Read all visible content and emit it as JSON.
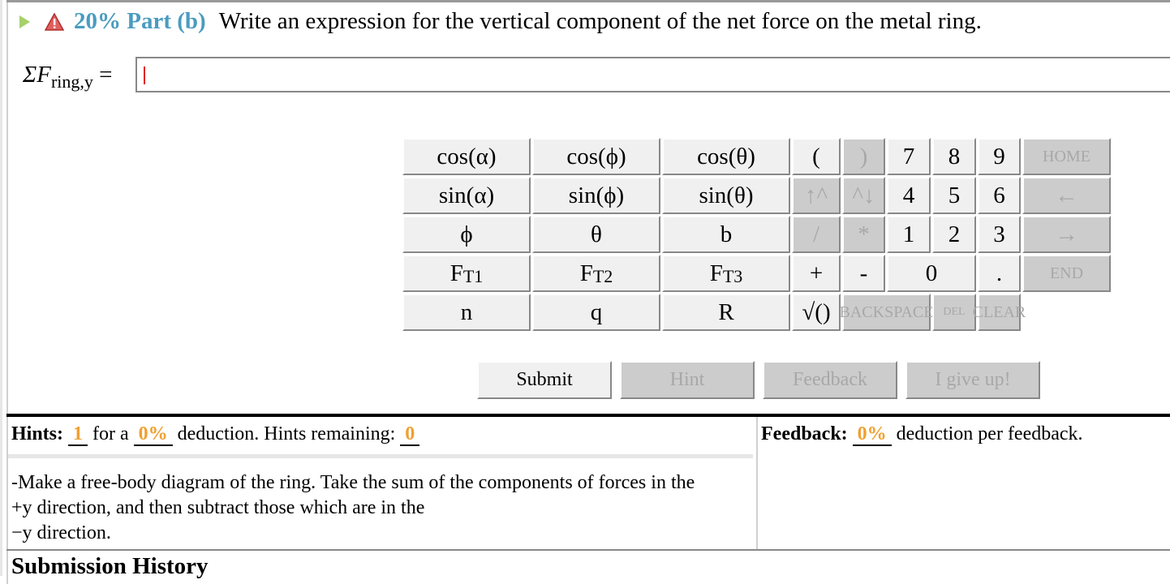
{
  "part": {
    "percent": "20%",
    "label": "Part (b)",
    "question": "Write an expression for the vertical component of the net force on the metal ring."
  },
  "equation": {
    "lhs_main": "ΣF",
    "lhs_sub": "ring,y",
    "equals": "="
  },
  "answer_input": {
    "value": ""
  },
  "keypad": [
    {
      "label": "cos(α)",
      "enabled": true
    },
    {
      "label": "cos(ϕ)",
      "enabled": true
    },
    {
      "label": "cos(θ)",
      "enabled": true
    },
    {
      "label": "(",
      "enabled": true
    },
    {
      "label": ")",
      "enabled": false
    },
    {
      "label": "7",
      "enabled": true
    },
    {
      "label": "8",
      "enabled": true
    },
    {
      "label": "9",
      "enabled": true
    },
    {
      "label": "HOME",
      "enabled": false
    },
    {
      "label": "sin(α)",
      "enabled": true
    },
    {
      "label": "sin(ϕ)",
      "enabled": true
    },
    {
      "label": "sin(θ)",
      "enabled": true
    },
    {
      "label": "↑^",
      "enabled": false
    },
    {
      "label": "^↓",
      "enabled": false
    },
    {
      "label": "4",
      "enabled": true
    },
    {
      "label": "5",
      "enabled": true
    },
    {
      "label": "6",
      "enabled": true
    },
    {
      "label": "←",
      "enabled": false
    },
    {
      "label": "ϕ",
      "enabled": true
    },
    {
      "label": "θ",
      "enabled": true
    },
    {
      "label": "b",
      "enabled": true
    },
    {
      "label": "/",
      "enabled": false
    },
    {
      "label": "*",
      "enabled": false
    },
    {
      "label": "1",
      "enabled": true
    },
    {
      "label": "2",
      "enabled": true
    },
    {
      "label": "3",
      "enabled": true
    },
    {
      "label": "→",
      "enabled": false
    },
    {
      "label": "F",
      "sub": "T1",
      "enabled": true
    },
    {
      "label": "F",
      "sub": "T2",
      "enabled": true
    },
    {
      "label": "F",
      "sub": "T3",
      "enabled": true
    },
    {
      "label": "+",
      "enabled": true
    },
    {
      "label": "-",
      "enabled": true
    },
    {
      "label": "0",
      "enabled": true
    },
    {
      "label": ".",
      "enabled": true
    },
    {
      "label": "END",
      "enabled": false
    },
    {
      "label": "n",
      "enabled": true
    },
    {
      "label": "q",
      "enabled": true
    },
    {
      "label": "R",
      "enabled": true
    },
    {
      "label": "√()",
      "enabled": true
    },
    {
      "label": "BACKSPACE",
      "enabled": false
    },
    {
      "label": "DEL",
      "enabled": false
    },
    {
      "label": "CLEAR",
      "enabled": false
    }
  ],
  "actions": {
    "submit": "Submit",
    "hint": "Hint",
    "feedback": "Feedback",
    "give_up": "I give up!"
  },
  "hints": {
    "label": "Hints:",
    "count": "1",
    "for_a": "for a",
    "deduction": "0%",
    "deduction_text": "deduction. Hints remaining:",
    "remaining": "0",
    "text_line1": "-Make a free-body diagram of the ring. Take the sum of the components of forces in the",
    "text_line2": "+y direction, and then subtract those which are in the",
    "text_line3": "−y direction."
  },
  "feedback": {
    "label": "Feedback:",
    "deduction": "0%",
    "text": "deduction per feedback."
  },
  "submission_history": "Submission History",
  "colors": {
    "accent": "#4a9cbf",
    "highlight": "#f0a030",
    "caret": "#e02020",
    "disabled_key": "#cccccc"
  }
}
